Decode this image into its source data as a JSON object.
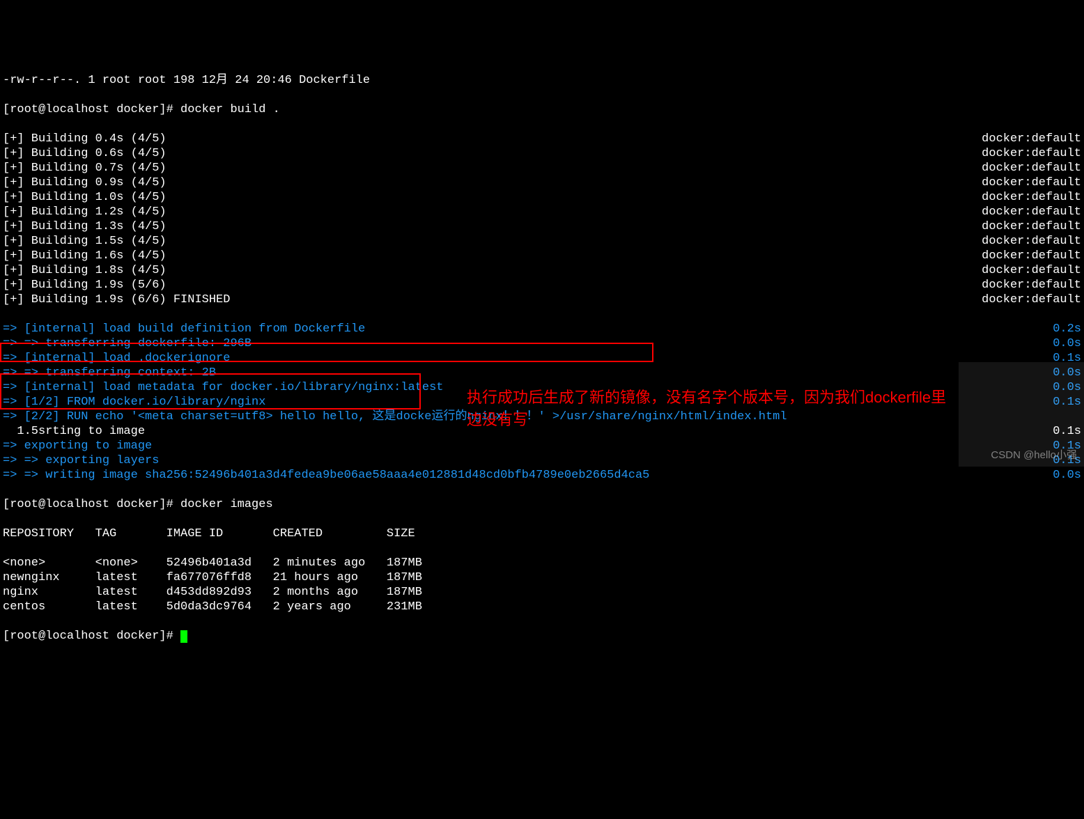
{
  "header": {
    "ls": "-rw-r--r--. 1 root root 198 12月 24 20:46 Dockerfile",
    "prompt1": "[root@localhost docker]# docker build ."
  },
  "builds": [
    {
      "l": "[+] Building 0.4s (4/5)",
      "r": "docker:default"
    },
    {
      "l": "[+] Building 0.6s (4/5)",
      "r": "docker:default"
    },
    {
      "l": "[+] Building 0.7s (4/5)",
      "r": "docker:default"
    },
    {
      "l": "[+] Building 0.9s (4/5)",
      "r": "docker:default"
    },
    {
      "l": "[+] Building 1.0s (4/5)",
      "r": "docker:default"
    },
    {
      "l": "[+] Building 1.2s (4/5)",
      "r": "docker:default"
    },
    {
      "l": "[+] Building 1.3s (4/5)",
      "r": "docker:default"
    },
    {
      "l": "[+] Building 1.5s (4/5)",
      "r": "docker:default"
    },
    {
      "l": "[+] Building 1.6s (4/5)",
      "r": "docker:default"
    },
    {
      "l": "[+] Building 1.8s (4/5)",
      "r": "docker:default"
    },
    {
      "l": "[+] Building 1.9s (5/6)",
      "r": "docker:default"
    },
    {
      "l": "[+] Building 1.9s (6/6) FINISHED",
      "r": "docker:default"
    }
  ],
  "steps": [
    {
      "l": "=> [internal] load build definition from Dockerfile",
      "r": "0.2s",
      "c": "blue"
    },
    {
      "l": "=> => transferring dockerfile: 296B",
      "r": "0.0s",
      "c": "blue"
    },
    {
      "l": "=> [internal] load .dockerignore",
      "r": "0.1s",
      "c": "blue"
    },
    {
      "l": "=> => transferring context: 2B",
      "r": "0.0s",
      "c": "blue"
    },
    {
      "l": "=> [internal] load metadata for docker.io/library/nginx:latest",
      "r": "0.0s",
      "c": "blue"
    },
    {
      "l": "=> [1/2] FROM docker.io/library/nginx",
      "r": "0.1s",
      "c": "blue"
    },
    {
      "l": "=> [2/2] RUN echo '<meta charset=utf8> hello hello, 这是docke运行的nginx！！！' >/usr/share/nginx/html/index.html",
      "r": "",
      "c": "blue"
    },
    {
      "l": "  1.5srting to image",
      "r": "0.1s",
      "c": "white"
    },
    {
      "l": "=> exporting to image",
      "r": "0.1s",
      "c": "blue"
    },
    {
      "l": "=> => exporting layers",
      "r": "0.1s",
      "c": "blue"
    },
    {
      "l": "=> => writing image sha256:52496b401a3d4fedea9be06ae58aaa4e012881d48cd0bfb4789e0eb2665d4ca5",
      "r": "0.0s",
      "c": "blue"
    }
  ],
  "prompt2": "[root@localhost docker]# docker images",
  "tableHeader": "REPOSITORY   TAG       IMAGE ID       CREATED         SIZE",
  "images": [
    "<none>       <none>    52496b401a3d   2 minutes ago   187MB",
    "newnginx     latest    fa677076ffd8   21 hours ago    187MB",
    "nginx        latest    d453dd892d93   2 months ago    187MB",
    "centos       latest    5d0da3dc9764   2 years ago     231MB"
  ],
  "prompt3": "[root@localhost docker]# ",
  "annotation": "执行成功后生成了新的镜像，没有名字个版本号，因为我们dockerfile里边没有写",
  "watermark": "CSDN @hello小强"
}
